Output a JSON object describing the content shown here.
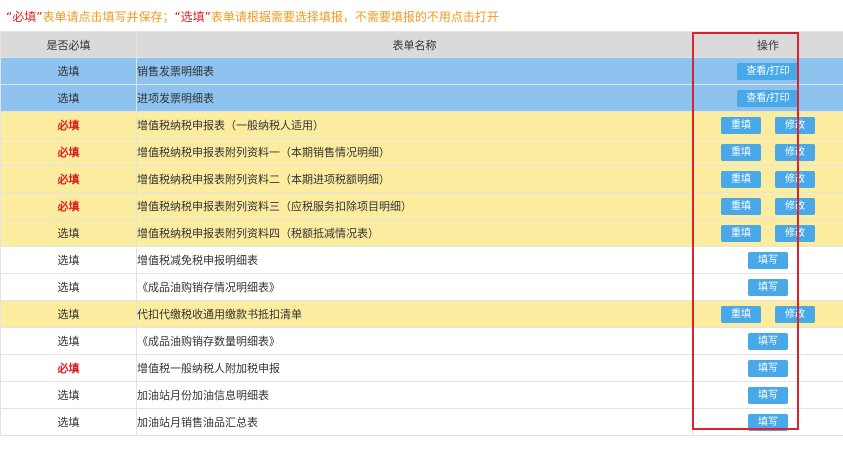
{
  "notice": {
    "parts": [
      {
        "text": "“必填”",
        "color": "#e02020"
      },
      {
        "text": "表单请点击填写并保存；",
        "color": "#f29a20"
      },
      {
        "text": "“选填”",
        "color": "#e02020"
      },
      {
        "text": "表单请根据需要选择填报，不需要填报的不用点击打开",
        "color": "#f29a20"
      }
    ]
  },
  "table": {
    "headers": {
      "required": "是否必填",
      "name": "表单名称",
      "ops": "操作"
    },
    "rows": [
      {
        "req": "选填",
        "required": false,
        "name": "销售发票明细表",
        "style": "blue",
        "buttons": [
          "查看/打印"
        ]
      },
      {
        "req": "选填",
        "required": false,
        "name": "进项发票明细表",
        "style": "blue",
        "buttons": [
          "查看/打印"
        ]
      },
      {
        "req": "必填",
        "required": true,
        "name": "增值税纳税申报表（一般纳税人适用）",
        "style": "yellow",
        "buttons": [
          "重填",
          "修改"
        ]
      },
      {
        "req": "必填",
        "required": true,
        "name": "增值税纳税申报表附列资料一（本期销售情况明细）",
        "style": "yellow",
        "buttons": [
          "重填",
          "修改"
        ]
      },
      {
        "req": "必填",
        "required": true,
        "name": "增值税纳税申报表附列资料二（本期进项税额明细）",
        "style": "yellow",
        "buttons": [
          "重填",
          "修改"
        ]
      },
      {
        "req": "必填",
        "required": true,
        "name": "增值税纳税申报表附列资料三（应税服务扣除项目明细）",
        "style": "yellow",
        "buttons": [
          "重填",
          "修改"
        ]
      },
      {
        "req": "选填",
        "required": false,
        "name": "增值税纳税申报表附列资料四（税额抵减情况表）",
        "style": "yellow",
        "buttons": [
          "重填",
          "修改"
        ]
      },
      {
        "req": "选填",
        "required": false,
        "name": "增值税减免税申报明细表",
        "style": "white",
        "buttons": [
          "填写"
        ]
      },
      {
        "req": "选填",
        "required": false,
        "name": "《成品油购销存情况明细表》",
        "style": "white",
        "buttons": [
          "填写"
        ]
      },
      {
        "req": "选填",
        "required": false,
        "name": "代扣代缴税收通用缴款书抵扣清单",
        "style": "yellow",
        "buttons": [
          "重填",
          "修改"
        ]
      },
      {
        "req": "选填",
        "required": false,
        "name": "《成品油购销存数量明细表》",
        "style": "white",
        "buttons": [
          "填写"
        ]
      },
      {
        "req": "必填",
        "required": true,
        "name": "增值税一般纳税人附加税申报",
        "style": "white",
        "buttons": [
          "填写"
        ]
      },
      {
        "req": "选填",
        "required": false,
        "name": "加油站月份加油信息明细表",
        "style": "white",
        "buttons": [
          "填写"
        ]
      },
      {
        "req": "选填",
        "required": false,
        "name": "加油站月销售油品汇总表",
        "style": "white",
        "buttons": [
          "填写"
        ]
      }
    ]
  },
  "colors": {
    "required_text": "#e02020",
    "notice_text": "#f29a20",
    "row_blue": "#8dc3ee",
    "row_yellow": "#fbeca0",
    "button": "#48a8e8",
    "highlight_border": "#d9232d"
  }
}
